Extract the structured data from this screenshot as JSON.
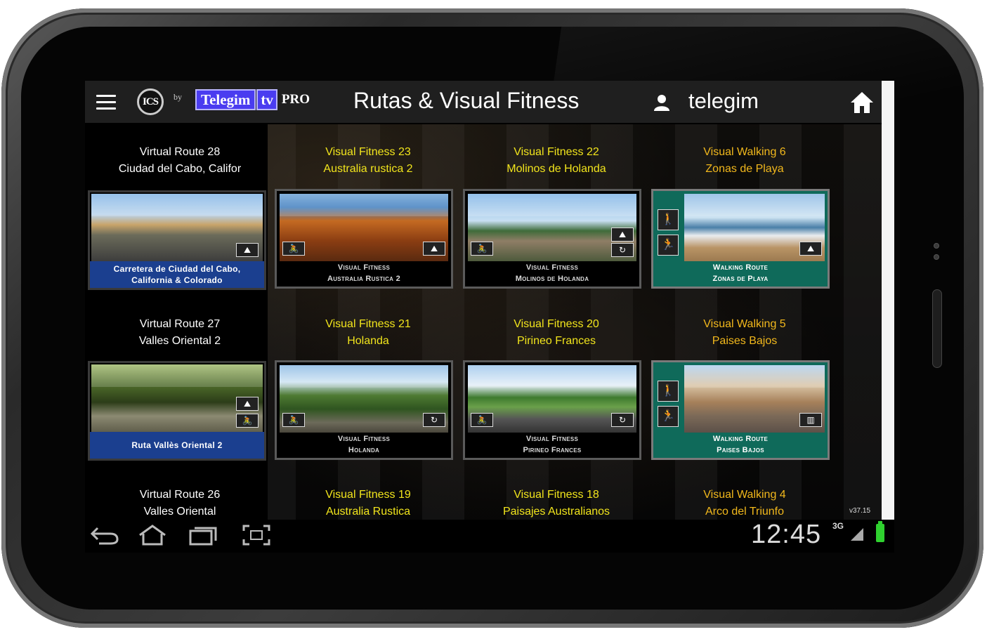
{
  "app": {
    "logo_ics": "ICS",
    "by": "by",
    "brand_left": "Telegim",
    "brand_right": "tv",
    "brand_pro": "PRO",
    "title": "Rutas & Visual Fitness",
    "user": "telegim"
  },
  "grid": [
    {
      "caption_line1": "Virtual Route 28",
      "caption_line2": "Ciudad del Cabo, Califor",
      "label_line1": "Carretera de Ciudad del Cabo,",
      "label_line2": "California & Colorado",
      "kind": "route"
    },
    {
      "caption_line1": "Visual Fitness 23",
      "caption_line2": "Australia rustica 2",
      "label_line1": "Visual Fitness",
      "label_line2": "Australia Rustica 2",
      "kind": "fit"
    },
    {
      "caption_line1": "Visual Fitness 22",
      "caption_line2": "Molinos de Holanda",
      "label_line1": "Visual Fitness",
      "label_line2": "Molinos de Holanda",
      "kind": "fit"
    },
    {
      "caption_line1": "Visual Walking 6",
      "caption_line2": "Zonas de Playa",
      "label_line1": "Walking Route",
      "label_line2": "Zonas de Playa",
      "kind": "walk"
    },
    {
      "caption_line1": "Virtual Route 27",
      "caption_line2": "Valles Oriental 2",
      "label_line1": "Ruta Vallès Oriental 2",
      "label_line2": "",
      "kind": "route"
    },
    {
      "caption_line1": "Visual Fitness 21",
      "caption_line2": "Holanda",
      "label_line1": "Visual Fitness",
      "label_line2": "Holanda",
      "kind": "fit"
    },
    {
      "caption_line1": "Visual Fitness 20",
      "caption_line2": "Pirineo Frances",
      "label_line1": "Visual Fitness",
      "label_line2": "Pirineo Frances",
      "kind": "fit"
    },
    {
      "caption_line1": "Visual Walking 5",
      "caption_line2": "Paises Bajos",
      "label_line1": "Walking Route",
      "label_line2": "Paises Bajos",
      "kind": "walk"
    },
    {
      "caption_line1": "Virtual Route 26",
      "caption_line2": "Valles Oriental",
      "kind": "route"
    },
    {
      "caption_line1": "Visual Fitness 19",
      "caption_line2": "Australia Rustica",
      "kind": "fit"
    },
    {
      "caption_line1": "Visual Fitness 18",
      "caption_line2": "Paisajes Australianos",
      "kind": "fit"
    },
    {
      "caption_line1": "Visual Walking 4",
      "caption_line2": "Arco del Triunfo",
      "kind": "walk"
    }
  ],
  "version": "v37.15",
  "status": {
    "time": "12:45",
    "network": "3G"
  },
  "colors": {
    "route_label_bg": "#1b3f8f",
    "walk_card_bg": "#0f6a5a",
    "fitness_caption": "#f2e51c",
    "walking_caption": "#f2b81c",
    "battery": "#2fd12f"
  },
  "icons": [
    "menu-icon",
    "user-icon",
    "home-icon",
    "back-icon",
    "nav-home-icon",
    "recent-apps-icon",
    "screenshot-icon",
    "signal-icon",
    "battery-icon"
  ]
}
